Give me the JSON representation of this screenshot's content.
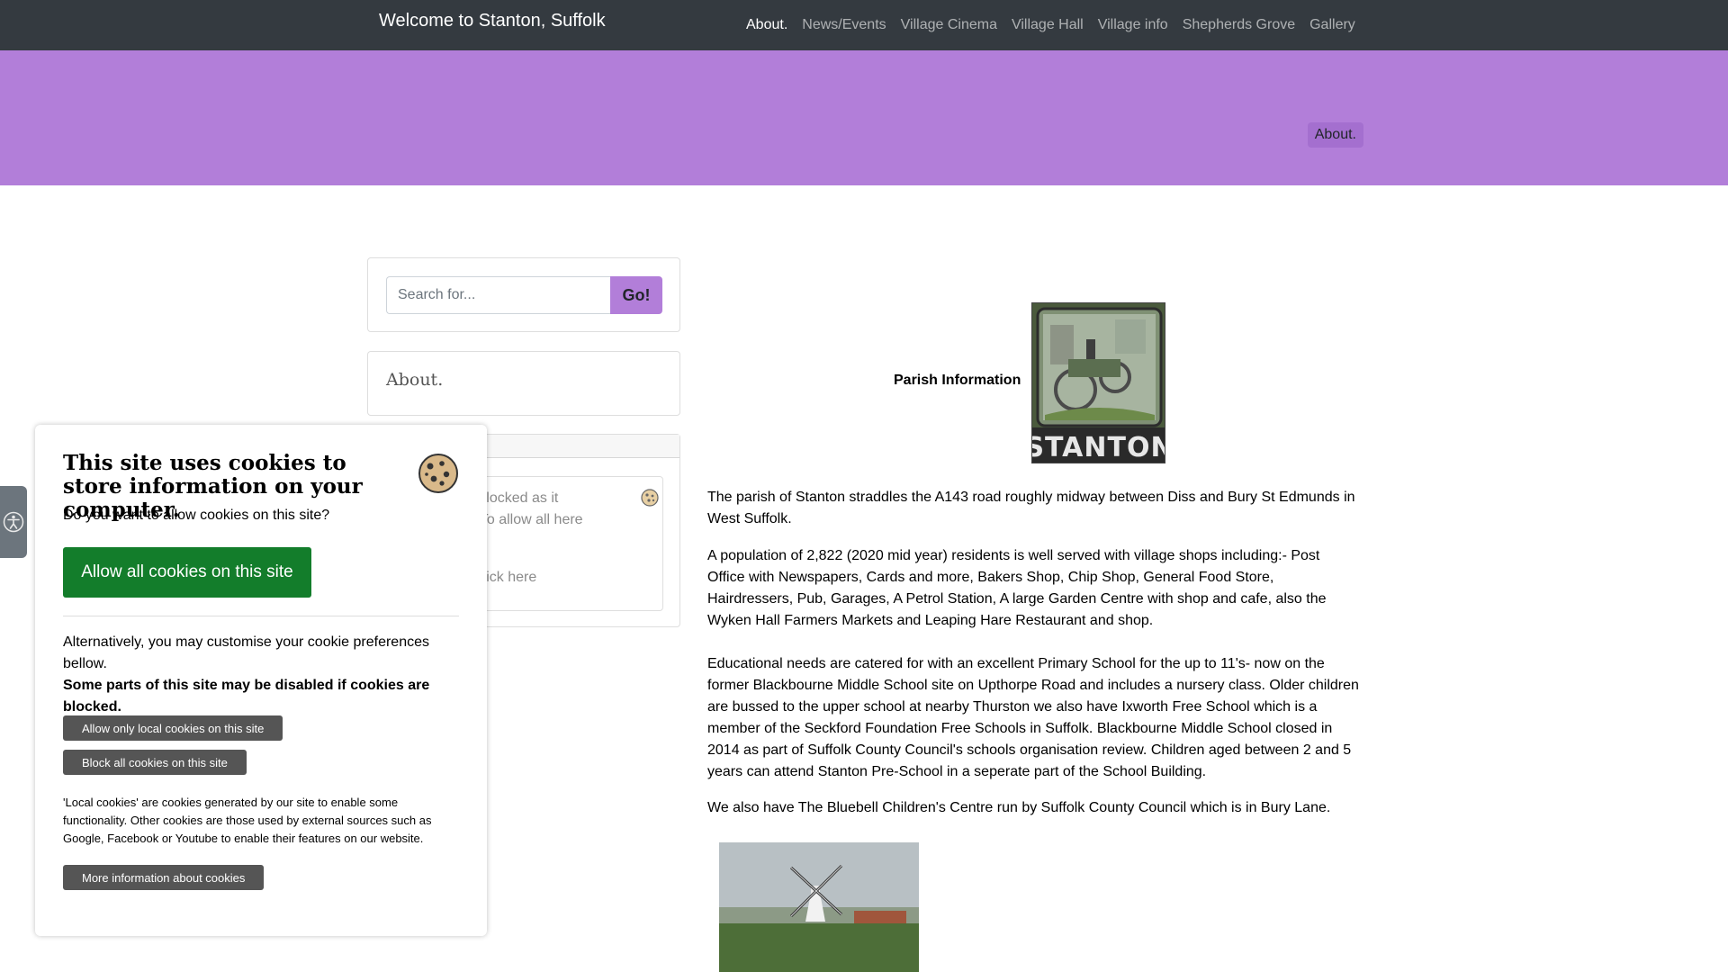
{
  "navbar": {
    "brand": "Welcome to Stanton, Suffolk",
    "links": [
      "About.",
      "News/Events",
      "Village Cinema",
      "Village Hall",
      "Village info",
      "Shepherds Grove",
      "Gallery"
    ],
    "active_index": 0
  },
  "header": {
    "breadcrumb": "About.",
    "band_color": "#b27ed9"
  },
  "sidebar": {
    "search": {
      "placeholder": "Search for...",
      "value": "",
      "button_label": "Go!"
    },
    "about_title": "About.",
    "blocked_widget": {
      "text": "as been blocked as it cookies. To allow all here",
      "policy_text": "e policy click here"
    }
  },
  "cookie_panel": {
    "title": "This site uses cookies to store information on your computer.",
    "question": "Do you want to allow cookies on this site?",
    "allow_all_label": "Allow all cookies on this site",
    "alternative": "Alternatively, you may customise your cookie preferences bellow.",
    "warning": "Some parts of this site may be disabled if cookies are blocked.",
    "allow_local_label": "Allow only local cookies on this site",
    "block_all_label": "Block all cookies on this site",
    "note": "'Local cookies' are cookies generated by our site to enable some functionality. Other cookies are those used by external sources such as Google, Facebook or Youtube to enable their features on our website.",
    "more_info_label": "More information about cookies",
    "allow_color": "#137d2b"
  },
  "main": {
    "parish_label": "Parish Information",
    "sign_text": "STANTON",
    "paragraphs": [
      "The parish of Stanton straddles the A143 road roughly midway between Diss and Bury St Edmunds in West Suffolk.",
      "A population of 2,822 (2020 mid year) residents is well served with village shops including:- Post Office with Newspapers, Cards and more, Bakers Shop, Chip Shop, General Food Store, Hairdressers, Pub, Garages, A Petrol Station, A large Garden Centre with shop and cafe, also the Wyken Hall Farmers Markets and Leaping Hare Restaurant and shop.",
      "Educational needs are catered for with an excellent Primary School for the up to 11's- now on the former Blackbourne Middle School site on Upthorpe Road and includes a nursery class. Older children are bussed to the upper school at nearby Thurston we also have Ixworth Free School which is a member of the Seckford Foundation Free Schools in Suffolk. Blackbourne Middle School closed in 2014 as part of Suffolk County Council's schools organisation review. Children aged between 2 and 5 years can attend Stanton Pre-School in a seperate part of the School Building.",
      "We also have The Bluebell Children's Centre run by Suffolk County Council which is in Bury Lane."
    ]
  }
}
